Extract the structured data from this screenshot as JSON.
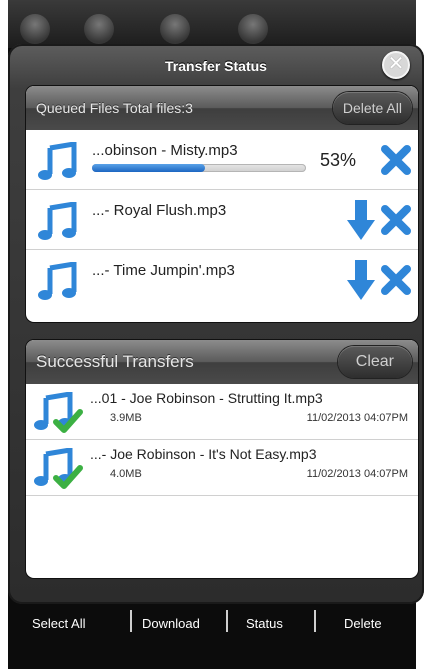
{
  "modal": {
    "title": "Transfer Status",
    "close_icon": "close-icon"
  },
  "queued": {
    "header": "Queued Files Total files:3",
    "action_label": "Delete All",
    "items": [
      {
        "name": "...obinson - Misty.mp3",
        "progress_percent": 53,
        "progress_label": "53%",
        "state": "transferring"
      },
      {
        "name": "...- Royal Flush.mp3",
        "state": "waiting"
      },
      {
        "name": "...- Time Jumpin'.mp3",
        "state": "waiting"
      }
    ]
  },
  "successful": {
    "header": "Successful Transfers",
    "action_label": "Clear",
    "items": [
      {
        "name": "...01 - Joe Robinson - Strutting It.mp3",
        "size": "3.9MB",
        "date": "11/02/2013 04:07PM"
      },
      {
        "name": "...- Joe Robinson - It's Not Easy.mp3",
        "size": "4.0MB",
        "date": "11/02/2013 04:07PM"
      }
    ]
  },
  "bottom_bar": {
    "items": [
      "Select All",
      "Download",
      "Status",
      "Delete"
    ]
  },
  "colors": {
    "icon_blue": "#2f86d8",
    "check_green": "#3cb043",
    "progress_blue": "#1c66c2"
  }
}
